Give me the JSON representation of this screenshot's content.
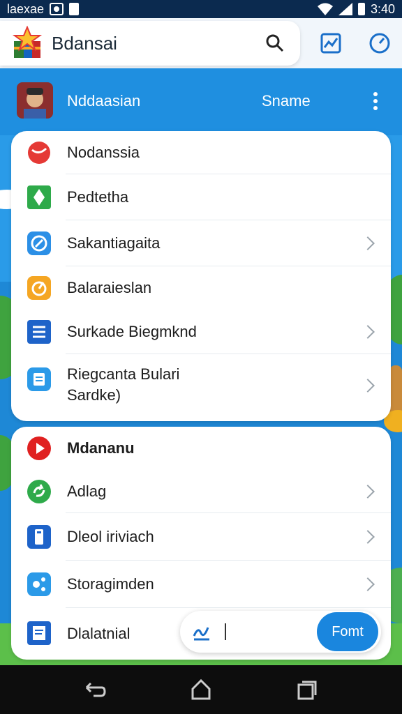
{
  "status_bar": {
    "left_text": "laexae",
    "time": "3:40"
  },
  "app_bar": {
    "title": "Bdansai"
  },
  "profile": {
    "name": "Nddaasian",
    "action_label": "Sname"
  },
  "menu_section_1": [
    {
      "label": "Nodanssia",
      "icon": "red-bird-icon",
      "color": "#e53935",
      "chevron": false
    },
    {
      "label": "Pedtetha",
      "icon": "green-diamond-icon",
      "color": "#2eaa4a",
      "chevron": false
    },
    {
      "label": "Sakantiagaita",
      "icon": "compass-icon",
      "color": "#2b8fe6",
      "chevron": true
    },
    {
      "label": "Balaraieslan",
      "icon": "orange-target-icon",
      "color": "#f5a623",
      "chevron": false
    },
    {
      "label": "Surkade Biegmknd",
      "icon": "document-list-icon",
      "color": "#1e63c9",
      "chevron": true
    },
    {
      "label": "Riegcanta Bulari",
      "label2": "Sardke)",
      "icon": "clipboard-icon",
      "color": "#2b9ae8",
      "chevron": true
    }
  ],
  "menu_section_2": [
    {
      "label": "Mdananu",
      "icon": "play-icon",
      "color": "#e02020",
      "chevron": false,
      "bold": true
    },
    {
      "label": "Adlag",
      "icon": "green-refresh-icon",
      "color": "#2eaa4a",
      "chevron": true
    },
    {
      "label": "Dleol iriviach",
      "icon": "phone-device-icon",
      "color": "#1e63c9",
      "chevron": true
    },
    {
      "label": "Storagimden",
      "icon": "share-icon",
      "color": "#2b9ae8",
      "chevron": true
    },
    {
      "label": "Dlalatnial",
      "icon": "note-edit-icon",
      "color": "#1e63c9",
      "chevron": false
    }
  ],
  "composer": {
    "button_label": "Fomt"
  },
  "colors": {
    "accent": "#1a86de",
    "status_bar": "#0b2a4f",
    "nav_bar": "#0d0d0d"
  }
}
